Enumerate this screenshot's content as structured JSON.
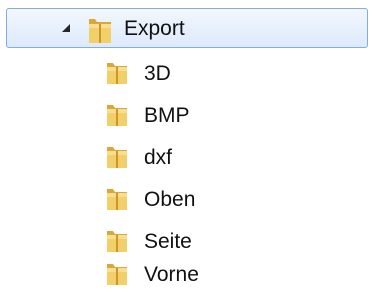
{
  "tree": {
    "root": {
      "label": "Export",
      "expanded": true,
      "selected": true,
      "expander_icon": "expanded-triangle-icon",
      "icon": "folder-icon"
    },
    "children": [
      {
        "label": "3D",
        "icon": "folder-icon"
      },
      {
        "label": "BMP",
        "icon": "folder-icon"
      },
      {
        "label": "dxf",
        "icon": "folder-icon"
      },
      {
        "label": "Oben",
        "icon": "folder-icon"
      },
      {
        "label": "Seite",
        "icon": "folder-icon"
      },
      {
        "label": "Vorne",
        "icon": "folder-icon"
      }
    ]
  },
  "colors": {
    "selection_border": "#84acdd",
    "selection_fill": "#dceafc",
    "folder_body": "#f0c85a",
    "folder_dark": "#c9982c"
  }
}
